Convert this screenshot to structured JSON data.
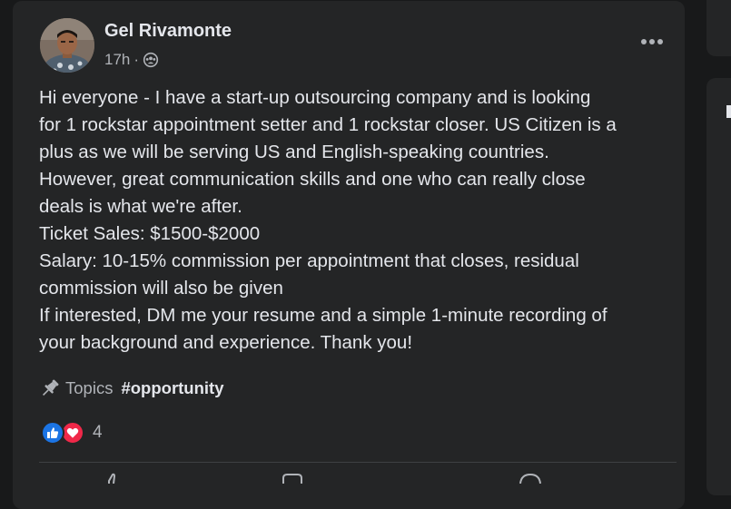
{
  "post": {
    "author": "Gel Rivamonte",
    "timestamp": "17h",
    "separator": "·",
    "audience_icon": "group-audience-icon",
    "more_icon": "more-options-icon",
    "body_lines": [
      "Hi everyone - I have a start-up outsourcing company and is looking",
      "for 1 rockstar appointment setter and 1 rockstar closer. US Citizen is a",
      "plus as we will be serving US and English-speaking countries.",
      "However, great communication skills and one who can really close",
      "deals is what we're after.",
      "Ticket Sales: $1500-$2000",
      "Salary: 10-15% commission per appointment that closes, residual",
      "commission will also be given",
      "If interested, DM me your resume and a simple 1-minute recording of",
      "your background and experience. Thank you!"
    ],
    "topics": {
      "icon": "pin-icon",
      "label": "Topics",
      "hashtag": "#opportunity"
    },
    "reactions": {
      "icons": [
        "like-icon",
        "love-icon"
      ],
      "count": "4"
    }
  },
  "colors": {
    "page_bg": "#18191a",
    "card_bg": "#242526",
    "primary_text": "#e4e6eb",
    "secondary_text": "#b0b3b8",
    "like_blue": "#1b74e4",
    "love_red": "#f02849"
  }
}
